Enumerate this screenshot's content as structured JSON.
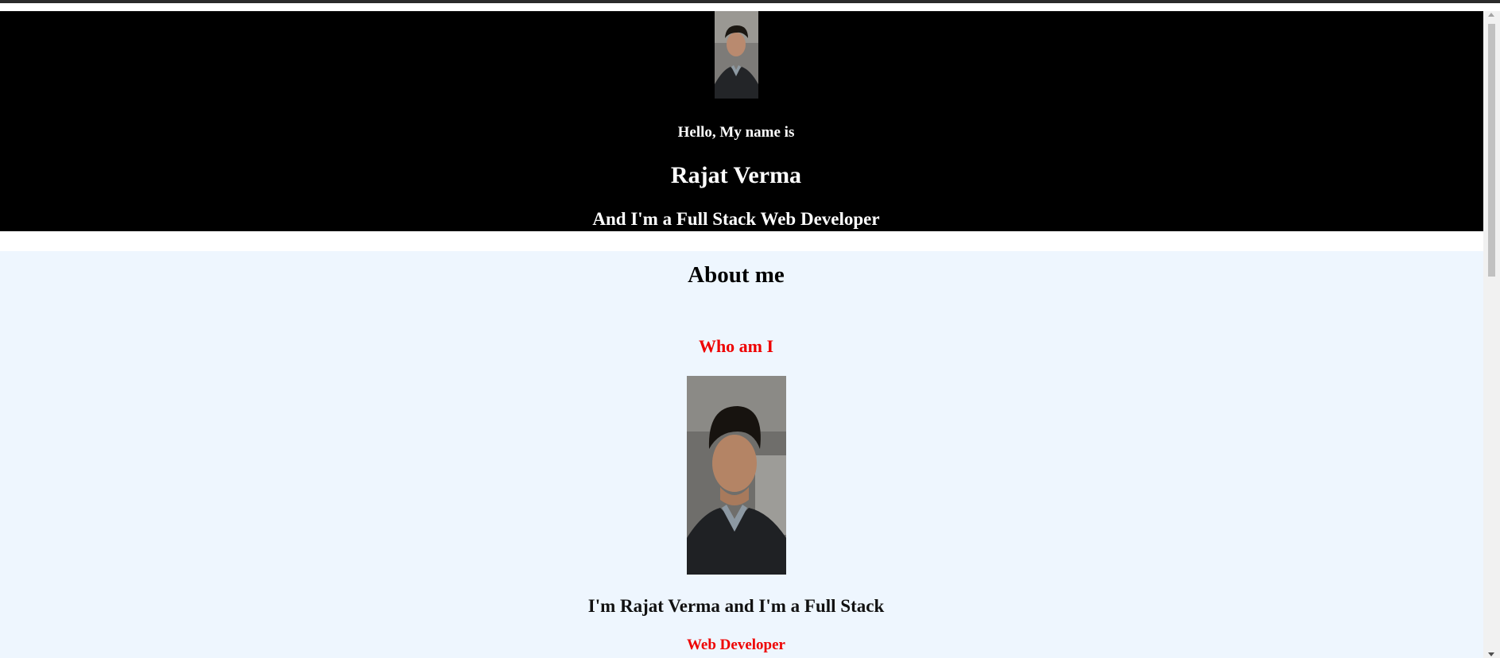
{
  "hero": {
    "photo_icon": "profile-photo",
    "greeting": "Hello, My name is",
    "name": "Rajat Verma",
    "role": "And I'm a Full Stack Web Developer"
  },
  "about": {
    "title": "About me",
    "subtitle": "Who am I",
    "photo_icon": "profile-photo",
    "intro": "I'm Rajat Verma and I'm a Full Stack",
    "intro_role": "Web Developer"
  },
  "colors": {
    "hero_bg": "#000000",
    "about_bg": "#eef6fe",
    "accent": "#ee0000"
  }
}
